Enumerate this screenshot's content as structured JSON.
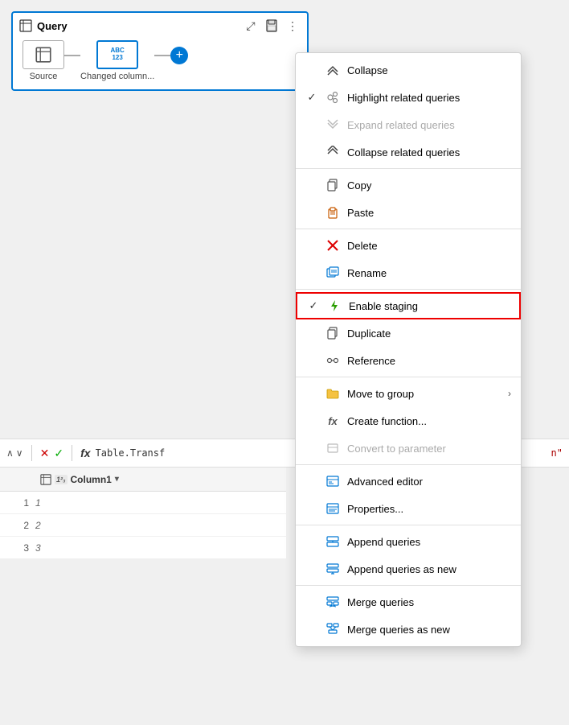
{
  "queryPanel": {
    "title": "Query",
    "steps": [
      {
        "label": "Source",
        "type": "table"
      },
      {
        "label": "Changed column...",
        "type": "abc123",
        "active": true
      }
    ]
  },
  "formulaBar": {
    "formula": "Table.Transf",
    "suffix": "n\""
  },
  "dataGrid": {
    "column": "Column1",
    "rows": [
      {
        "num": 1,
        "value": "1"
      },
      {
        "num": 2,
        "value": "2"
      },
      {
        "num": 3,
        "value": "3"
      }
    ]
  },
  "contextMenu": {
    "items": [
      {
        "id": "collapse",
        "label": "Collapse",
        "icon": "collapse",
        "check": false,
        "disabled": false,
        "dividerAfter": false
      },
      {
        "id": "highlight-related",
        "label": "Highlight related queries",
        "icon": "related",
        "check": true,
        "disabled": false,
        "dividerAfter": false
      },
      {
        "id": "expand-related",
        "label": "Expand related queries",
        "icon": "expand-related",
        "check": false,
        "disabled": true,
        "dividerAfter": false
      },
      {
        "id": "collapse-related",
        "label": "Collapse related queries",
        "icon": "collapse-related",
        "check": false,
        "disabled": false,
        "dividerAfter": true
      },
      {
        "id": "copy",
        "label": "Copy",
        "icon": "copy",
        "check": false,
        "disabled": false,
        "dividerAfter": false
      },
      {
        "id": "paste",
        "label": "Paste",
        "icon": "paste",
        "check": false,
        "disabled": false,
        "dividerAfter": true
      },
      {
        "id": "delete",
        "label": "Delete",
        "icon": "delete",
        "check": false,
        "disabled": false,
        "dividerAfter": false
      },
      {
        "id": "rename",
        "label": "Rename",
        "icon": "rename",
        "check": false,
        "disabled": false,
        "dividerAfter": true
      },
      {
        "id": "enable-staging",
        "label": "Enable staging",
        "icon": "lightning",
        "check": true,
        "disabled": false,
        "highlighted": true,
        "dividerAfter": false
      },
      {
        "id": "duplicate",
        "label": "Duplicate",
        "icon": "duplicate",
        "check": false,
        "disabled": false,
        "dividerAfter": false
      },
      {
        "id": "reference",
        "label": "Reference",
        "icon": "reference",
        "check": false,
        "disabled": false,
        "dividerAfter": true
      },
      {
        "id": "move-to-group",
        "label": "Move to group",
        "icon": "folder",
        "check": false,
        "disabled": false,
        "hasSubmenu": true,
        "dividerAfter": false
      },
      {
        "id": "create-function",
        "label": "Create function...",
        "icon": "fx",
        "check": false,
        "disabled": false,
        "dividerAfter": false
      },
      {
        "id": "convert-to-parameter",
        "label": "Convert to parameter",
        "icon": "convert",
        "check": false,
        "disabled": true,
        "dividerAfter": true
      },
      {
        "id": "advanced-editor",
        "label": "Advanced editor",
        "icon": "advanced",
        "check": false,
        "disabled": false,
        "dividerAfter": false
      },
      {
        "id": "properties",
        "label": "Properties...",
        "icon": "properties",
        "check": false,
        "disabled": false,
        "dividerAfter": true
      },
      {
        "id": "append-queries",
        "label": "Append queries",
        "icon": "append",
        "check": false,
        "disabled": false,
        "dividerAfter": false
      },
      {
        "id": "append-queries-new",
        "label": "Append queries as new",
        "icon": "append-new",
        "check": false,
        "disabled": false,
        "dividerAfter": true
      },
      {
        "id": "merge-queries",
        "label": "Merge queries",
        "icon": "merge",
        "check": false,
        "disabled": false,
        "dividerAfter": false
      },
      {
        "id": "merge-queries-new",
        "label": "Merge queries as new",
        "icon": "merge-new",
        "check": false,
        "disabled": false,
        "dividerAfter": false
      }
    ]
  }
}
